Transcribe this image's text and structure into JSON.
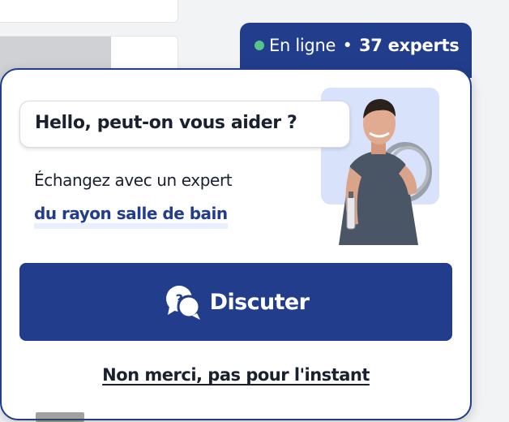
{
  "status": {
    "online_label": "En ligne",
    "separator": "•",
    "experts_count": "37 experts",
    "dot_color": "#56c48a"
  },
  "widget": {
    "greeting": "Hello, peut-on vous aider ?",
    "subtitle": "Échangez avec un expert",
    "department": "du rayon salle de bain",
    "chat_button_label": "Discuter",
    "chat_icon": "chat-question-icon",
    "dismiss_label": "Non merci, pas pour l'instant",
    "accent_color": "#223d8b"
  }
}
